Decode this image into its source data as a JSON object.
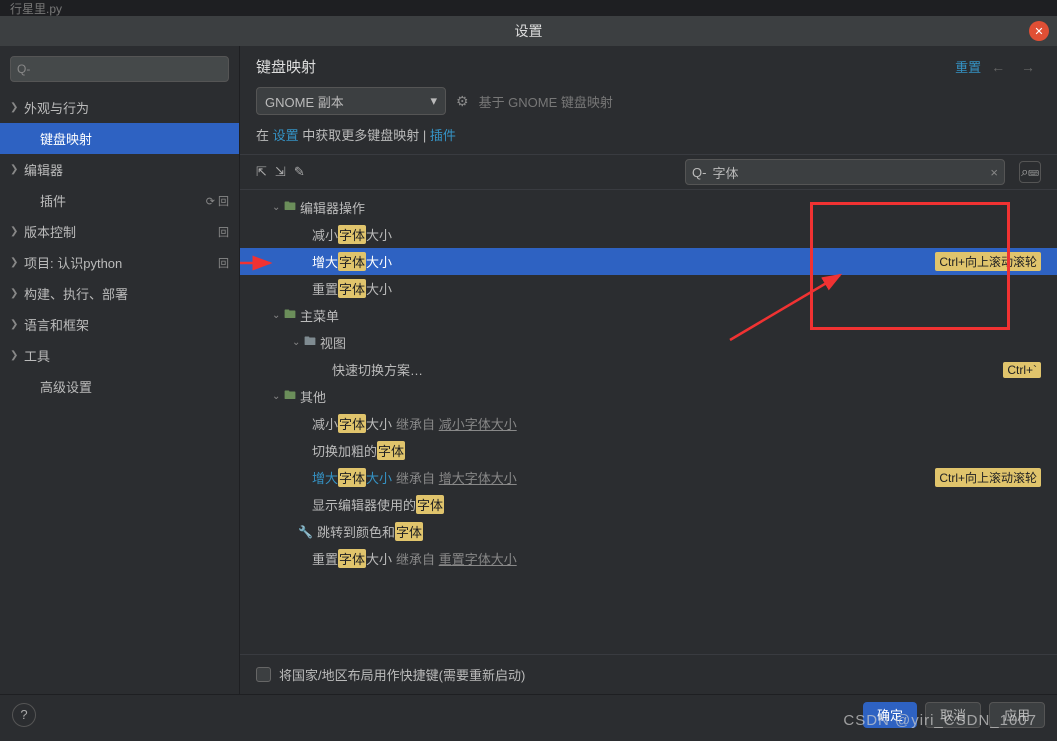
{
  "tab_filename": "行星里.py",
  "dialog_title": "设置",
  "sidebar_search_placeholder": "Q-",
  "sidebar": {
    "items": [
      {
        "label": "外观与行为",
        "expandable": true
      },
      {
        "label": "键盘映射",
        "selected": true
      },
      {
        "label": "编辑器",
        "expandable": true
      },
      {
        "label": "插件",
        "badge": "⟳ 回"
      },
      {
        "label": "版本控制",
        "expandable": true,
        "badge": "回"
      },
      {
        "label": "项目: 认识python",
        "expandable": true,
        "badge": "回"
      },
      {
        "label": "构建、执行、部署",
        "expandable": true
      },
      {
        "label": "语言和框架",
        "expandable": true
      },
      {
        "label": "工具",
        "expandable": true
      },
      {
        "label": "高级设置"
      }
    ]
  },
  "content": {
    "title": "键盘映射",
    "reset": "重置",
    "dropdown": "GNOME 副本",
    "based_on": "基于 GNOME 键盘映射",
    "more_link_prefix": "在 ",
    "more_link": "设置",
    "more_link_mid": " 中获取更多键盘映射 | ",
    "more_link_plugin": "插件",
    "search_value": "字体",
    "checkbox_label": "将国家/地区布局用作快捷键(需要重新启动)"
  },
  "tree": {
    "editor_ops": "编辑器操作",
    "decrease_pre": "减小",
    "decrease_hl": "字体",
    "decrease_post": "大小",
    "increase_pre": "增大",
    "increase_hl": "字体",
    "increase_post": "大小",
    "increase_shortcut": "Ctrl+向上滚动滚轮",
    "reset_pre": "重置",
    "reset_hl": "字体",
    "reset_post": "大小",
    "main_menu": "主菜单",
    "view": "视图",
    "quick_switch": "快速切换方案…",
    "quick_switch_shortcut": "Ctrl+`",
    "other": "其他",
    "o_decrease_pre": "减小",
    "o_decrease_hl": "字体",
    "o_decrease_post": "大小",
    "o_inherit_decrease": "减小字体大小",
    "o_bold_pre": "切换加粗的",
    "o_bold_hl": "字体",
    "o_increase_pre": "增大",
    "o_increase_hl": "字体",
    "o_increase_post": "大小",
    "o_inherit_increase": "增大字体大小",
    "o_increase_shortcut": "Ctrl+向上滚动滚轮",
    "o_show_pre": "显示编辑器使用的",
    "o_show_hl": "字体",
    "o_jump_pre": "跳转到颜色和",
    "o_jump_hl": "字体",
    "o_reset_pre": "重置",
    "o_reset_hl": "字体",
    "o_reset_post": "大小",
    "o_inherit_reset": "重置字体大小",
    "inherit_label": "继承自"
  },
  "buttons": {
    "ok": "确定",
    "cancel": "取消",
    "apply": "应用"
  },
  "watermark": "CSDN @yiri_CSDN_1007"
}
